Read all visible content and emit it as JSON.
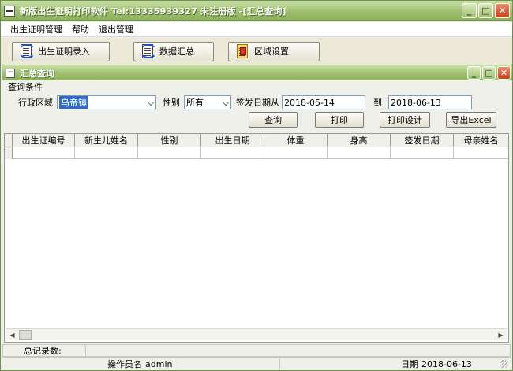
{
  "window": {
    "title": "新版出生证明打印软件    Tel:13335939327  未注册版      -[汇总查询]"
  },
  "menu": [
    "出生证明管理",
    "帮助",
    "退出管理"
  ],
  "toolbar": {
    "entry_label": "出生证明录入",
    "summary_label": "数据汇总",
    "region_label": "区域设置"
  },
  "subwindow": {
    "title": "汇总查询"
  },
  "filters": {
    "group_label": "查询条件",
    "region_label": "行政区域",
    "region_value": "乌帝镇",
    "gender_label": "性别",
    "gender_value": "所有",
    "date_from_label": "签发日期从",
    "date_from": "2018-05-14",
    "date_to_label": "到",
    "date_to": "2018-06-13"
  },
  "actions": {
    "query": "查询",
    "print": "打印",
    "print_design": "打印设计",
    "export": "导出Excel"
  },
  "table": {
    "columns": [
      "出生证编号",
      "新生儿姓名",
      "性别",
      "出生日期",
      "体重",
      "身高",
      "签发日期",
      "母亲姓名"
    ]
  },
  "status": {
    "total_label": "总记录数:",
    "total_value": "",
    "operator_label": "操作员名",
    "operator_value": "admin",
    "date_label": "日期",
    "date_value": "2018-06-13"
  }
}
